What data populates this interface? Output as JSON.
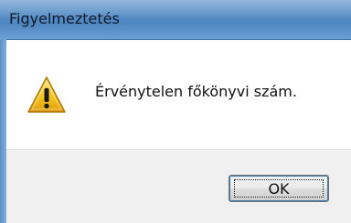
{
  "window": {
    "title": "Figyelmeztetés"
  },
  "dialog": {
    "icon": "warning-icon",
    "message": "Érvénytelen főkönyvi szám."
  },
  "buttons": {
    "ok_label": "OK"
  },
  "colors": {
    "titlebar": "#5f93c9",
    "content_bg": "#ffffff",
    "footer_bg": "#f0f0f0",
    "warning_yellow": "#f4c21b",
    "button_focus": "#3c7fb1"
  }
}
